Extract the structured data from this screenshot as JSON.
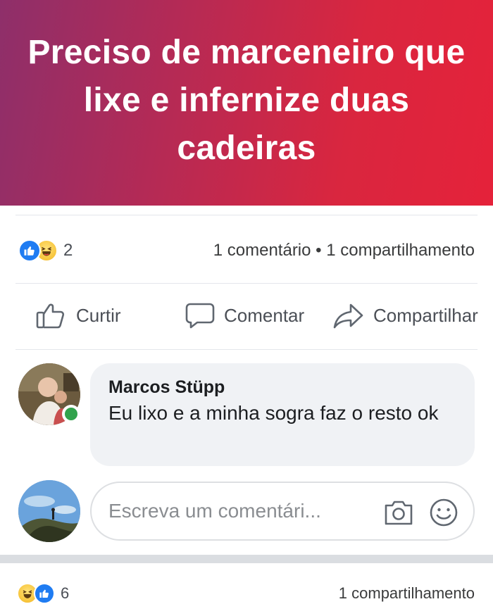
{
  "post": {
    "banner_text": "Preciso de marceneiro que lixe e infernize duas cadeiras",
    "banner_colors": [
      "#8e2f6a",
      "#e5223a"
    ],
    "reactions": {
      "icons": [
        "like-icon",
        "haha-icon"
      ],
      "count": "2"
    },
    "stats_text": "1 comentário • 1 compartilhamento",
    "actions": {
      "like_label": "Curtir",
      "comment_label": "Comentar",
      "share_label": "Compartilhar"
    }
  },
  "comment": {
    "author": "Marcos Stüpp",
    "text": "Eu lixo e a minha sogra faz o resto ok",
    "online": true
  },
  "comment_box": {
    "placeholder": "Escreva um comentári...",
    "icons": [
      "camera-icon",
      "emoji-icon"
    ]
  },
  "next_post": {
    "reactions": {
      "icons": [
        "haha-icon",
        "like-icon"
      ],
      "count": "6"
    },
    "stats_text": "1 compartilhamento"
  },
  "colors": {
    "accent": "#1f7cf2",
    "online": "#31a24c"
  }
}
